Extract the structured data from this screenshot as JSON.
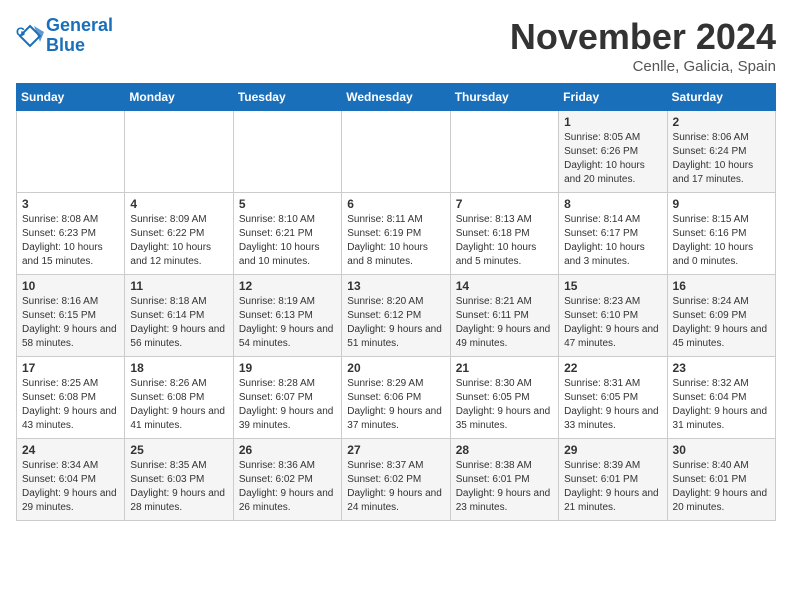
{
  "header": {
    "logo_line1": "General",
    "logo_line2": "Blue",
    "month_title": "November 2024",
    "location": "Cenlle, Galicia, Spain"
  },
  "days_of_week": [
    "Sunday",
    "Monday",
    "Tuesday",
    "Wednesday",
    "Thursday",
    "Friday",
    "Saturday"
  ],
  "weeks": [
    [
      {
        "day": "",
        "info": ""
      },
      {
        "day": "",
        "info": ""
      },
      {
        "day": "",
        "info": ""
      },
      {
        "day": "",
        "info": ""
      },
      {
        "day": "",
        "info": ""
      },
      {
        "day": "1",
        "info": "Sunrise: 8:05 AM\nSunset: 6:26 PM\nDaylight: 10 hours and 20 minutes."
      },
      {
        "day": "2",
        "info": "Sunrise: 8:06 AM\nSunset: 6:24 PM\nDaylight: 10 hours and 17 minutes."
      }
    ],
    [
      {
        "day": "3",
        "info": "Sunrise: 8:08 AM\nSunset: 6:23 PM\nDaylight: 10 hours and 15 minutes."
      },
      {
        "day": "4",
        "info": "Sunrise: 8:09 AM\nSunset: 6:22 PM\nDaylight: 10 hours and 12 minutes."
      },
      {
        "day": "5",
        "info": "Sunrise: 8:10 AM\nSunset: 6:21 PM\nDaylight: 10 hours and 10 minutes."
      },
      {
        "day": "6",
        "info": "Sunrise: 8:11 AM\nSunset: 6:19 PM\nDaylight: 10 hours and 8 minutes."
      },
      {
        "day": "7",
        "info": "Sunrise: 8:13 AM\nSunset: 6:18 PM\nDaylight: 10 hours and 5 minutes."
      },
      {
        "day": "8",
        "info": "Sunrise: 8:14 AM\nSunset: 6:17 PM\nDaylight: 10 hours and 3 minutes."
      },
      {
        "day": "9",
        "info": "Sunrise: 8:15 AM\nSunset: 6:16 PM\nDaylight: 10 hours and 0 minutes."
      }
    ],
    [
      {
        "day": "10",
        "info": "Sunrise: 8:16 AM\nSunset: 6:15 PM\nDaylight: 9 hours and 58 minutes."
      },
      {
        "day": "11",
        "info": "Sunrise: 8:18 AM\nSunset: 6:14 PM\nDaylight: 9 hours and 56 minutes."
      },
      {
        "day": "12",
        "info": "Sunrise: 8:19 AM\nSunset: 6:13 PM\nDaylight: 9 hours and 54 minutes."
      },
      {
        "day": "13",
        "info": "Sunrise: 8:20 AM\nSunset: 6:12 PM\nDaylight: 9 hours and 51 minutes."
      },
      {
        "day": "14",
        "info": "Sunrise: 8:21 AM\nSunset: 6:11 PM\nDaylight: 9 hours and 49 minutes."
      },
      {
        "day": "15",
        "info": "Sunrise: 8:23 AM\nSunset: 6:10 PM\nDaylight: 9 hours and 47 minutes."
      },
      {
        "day": "16",
        "info": "Sunrise: 8:24 AM\nSunset: 6:09 PM\nDaylight: 9 hours and 45 minutes."
      }
    ],
    [
      {
        "day": "17",
        "info": "Sunrise: 8:25 AM\nSunset: 6:08 PM\nDaylight: 9 hours and 43 minutes."
      },
      {
        "day": "18",
        "info": "Sunrise: 8:26 AM\nSunset: 6:08 PM\nDaylight: 9 hours and 41 minutes."
      },
      {
        "day": "19",
        "info": "Sunrise: 8:28 AM\nSunset: 6:07 PM\nDaylight: 9 hours and 39 minutes."
      },
      {
        "day": "20",
        "info": "Sunrise: 8:29 AM\nSunset: 6:06 PM\nDaylight: 9 hours and 37 minutes."
      },
      {
        "day": "21",
        "info": "Sunrise: 8:30 AM\nSunset: 6:05 PM\nDaylight: 9 hours and 35 minutes."
      },
      {
        "day": "22",
        "info": "Sunrise: 8:31 AM\nSunset: 6:05 PM\nDaylight: 9 hours and 33 minutes."
      },
      {
        "day": "23",
        "info": "Sunrise: 8:32 AM\nSunset: 6:04 PM\nDaylight: 9 hours and 31 minutes."
      }
    ],
    [
      {
        "day": "24",
        "info": "Sunrise: 8:34 AM\nSunset: 6:04 PM\nDaylight: 9 hours and 29 minutes."
      },
      {
        "day": "25",
        "info": "Sunrise: 8:35 AM\nSunset: 6:03 PM\nDaylight: 9 hours and 28 minutes."
      },
      {
        "day": "26",
        "info": "Sunrise: 8:36 AM\nSunset: 6:02 PM\nDaylight: 9 hours and 26 minutes."
      },
      {
        "day": "27",
        "info": "Sunrise: 8:37 AM\nSunset: 6:02 PM\nDaylight: 9 hours and 24 minutes."
      },
      {
        "day": "28",
        "info": "Sunrise: 8:38 AM\nSunset: 6:01 PM\nDaylight: 9 hours and 23 minutes."
      },
      {
        "day": "29",
        "info": "Sunrise: 8:39 AM\nSunset: 6:01 PM\nDaylight: 9 hours and 21 minutes."
      },
      {
        "day": "30",
        "info": "Sunrise: 8:40 AM\nSunset: 6:01 PM\nDaylight: 9 hours and 20 minutes."
      }
    ]
  ]
}
